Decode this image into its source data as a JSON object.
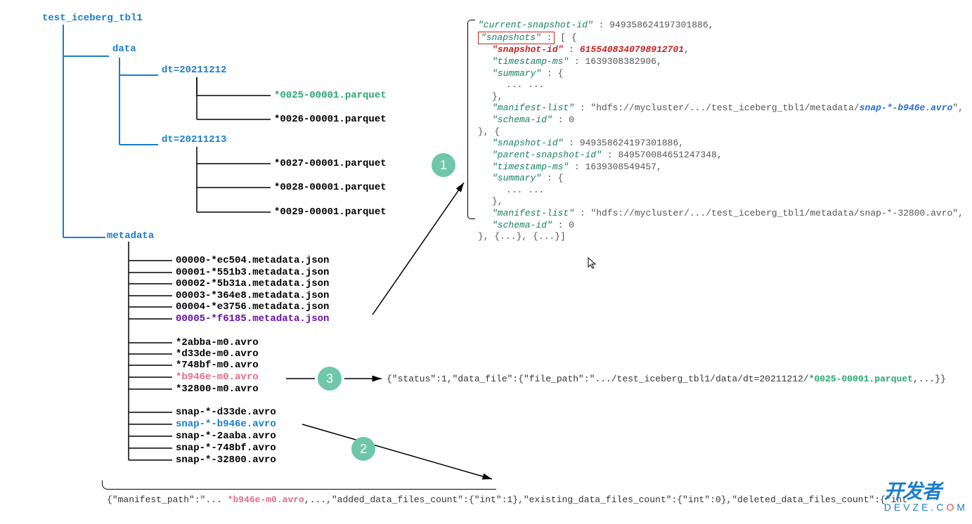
{
  "tree": {
    "root": "test_iceberg_tbl1",
    "data": {
      "label": "data",
      "dt1": {
        "label": "dt=20211212",
        "files": [
          "*0025-00001.parquet",
          "*0026-00001.parquet"
        ]
      },
      "dt2": {
        "label": "dt=20211213",
        "files": [
          "*0027-00001.parquet",
          "*0028-00001.parquet",
          "*0029-00001.parquet"
        ]
      }
    },
    "metadata": {
      "label": "metadata",
      "json_files": [
        "00000-*ec504.metadata.json",
        "00001-*551b3.metadata.json",
        "00002-*5b31a.metadata.json",
        "00003-*364e8.metadata.json",
        "00004-*e3756.metadata.json",
        "00005-*f6185.metadata.json"
      ],
      "m_avro": [
        "*2abba-m0.avro",
        "*d33de-m0.avro",
        "*748bf-m0.avro",
        "*b946e-m0.avro",
        "*32800-m0.avro"
      ],
      "snap_avro": [
        "snap-*-d33de.avro",
        "snap-*-b946e.avro",
        "snap-*-2aaba.avro",
        "snap-*-748bf.avro",
        "snap-*-32800.avro"
      ]
    }
  },
  "badges": {
    "b1": "1",
    "b2": "2",
    "b3": "3"
  },
  "json1": {
    "current_snapshot_id": "949358624197301886",
    "snapshots_label": "snapshots",
    "s0_snapshot_id_k": "snapshot-id",
    "s0_snapshot_id_v": "6155408340798912701",
    "s0_timestamp": "1639308382906",
    "s0_summary": "{",
    "s0_dots": "... ...",
    "s0_manifest_list": "hdfs://mycluster/.../test_iceberg_tbl1/metadata/",
    "s0_manifest_list_file": "snap-*-b946e.avro",
    "s0_schema_id": "0",
    "s1_snapshot_id": "949358624197301886",
    "s1_parent": "849570084651247348",
    "s1_timestamp": "1639308549457",
    "s1_summary": "{",
    "s1_dots": "... ...",
    "s1_manifest_list": "hdfs://mycluster/.../test_iceberg_tbl1/metadata/snap-*-32800.avro",
    "s1_schema_id": "0",
    "close": "}, {...}, {...}]"
  },
  "json3_pre": "{\"status\":1,\"data_file\":{\"file_path\":\".../test_iceberg_tbl1/data/dt=20211212/",
  "json3_file": "*0025-00001.parquet",
  "json3_post": ",...}}",
  "json2_pre": "{\"manifest_path\":\"... ",
  "json2_file": "*b946e-m0.avro",
  "json2_post": ",...,\"added_data_files_count\":{\"int\":1},\"existing_data_files_count\":{\"int\":0},\"deleted_data_files_count\":{\"int",
  "watermark": {
    "top": "开发者",
    "line1a": "D",
    "line1b": "E",
    "line1c": "V",
    "line1d": "Z",
    "line1e": "E.C",
    "line1f": "O",
    "line1g": "M"
  }
}
